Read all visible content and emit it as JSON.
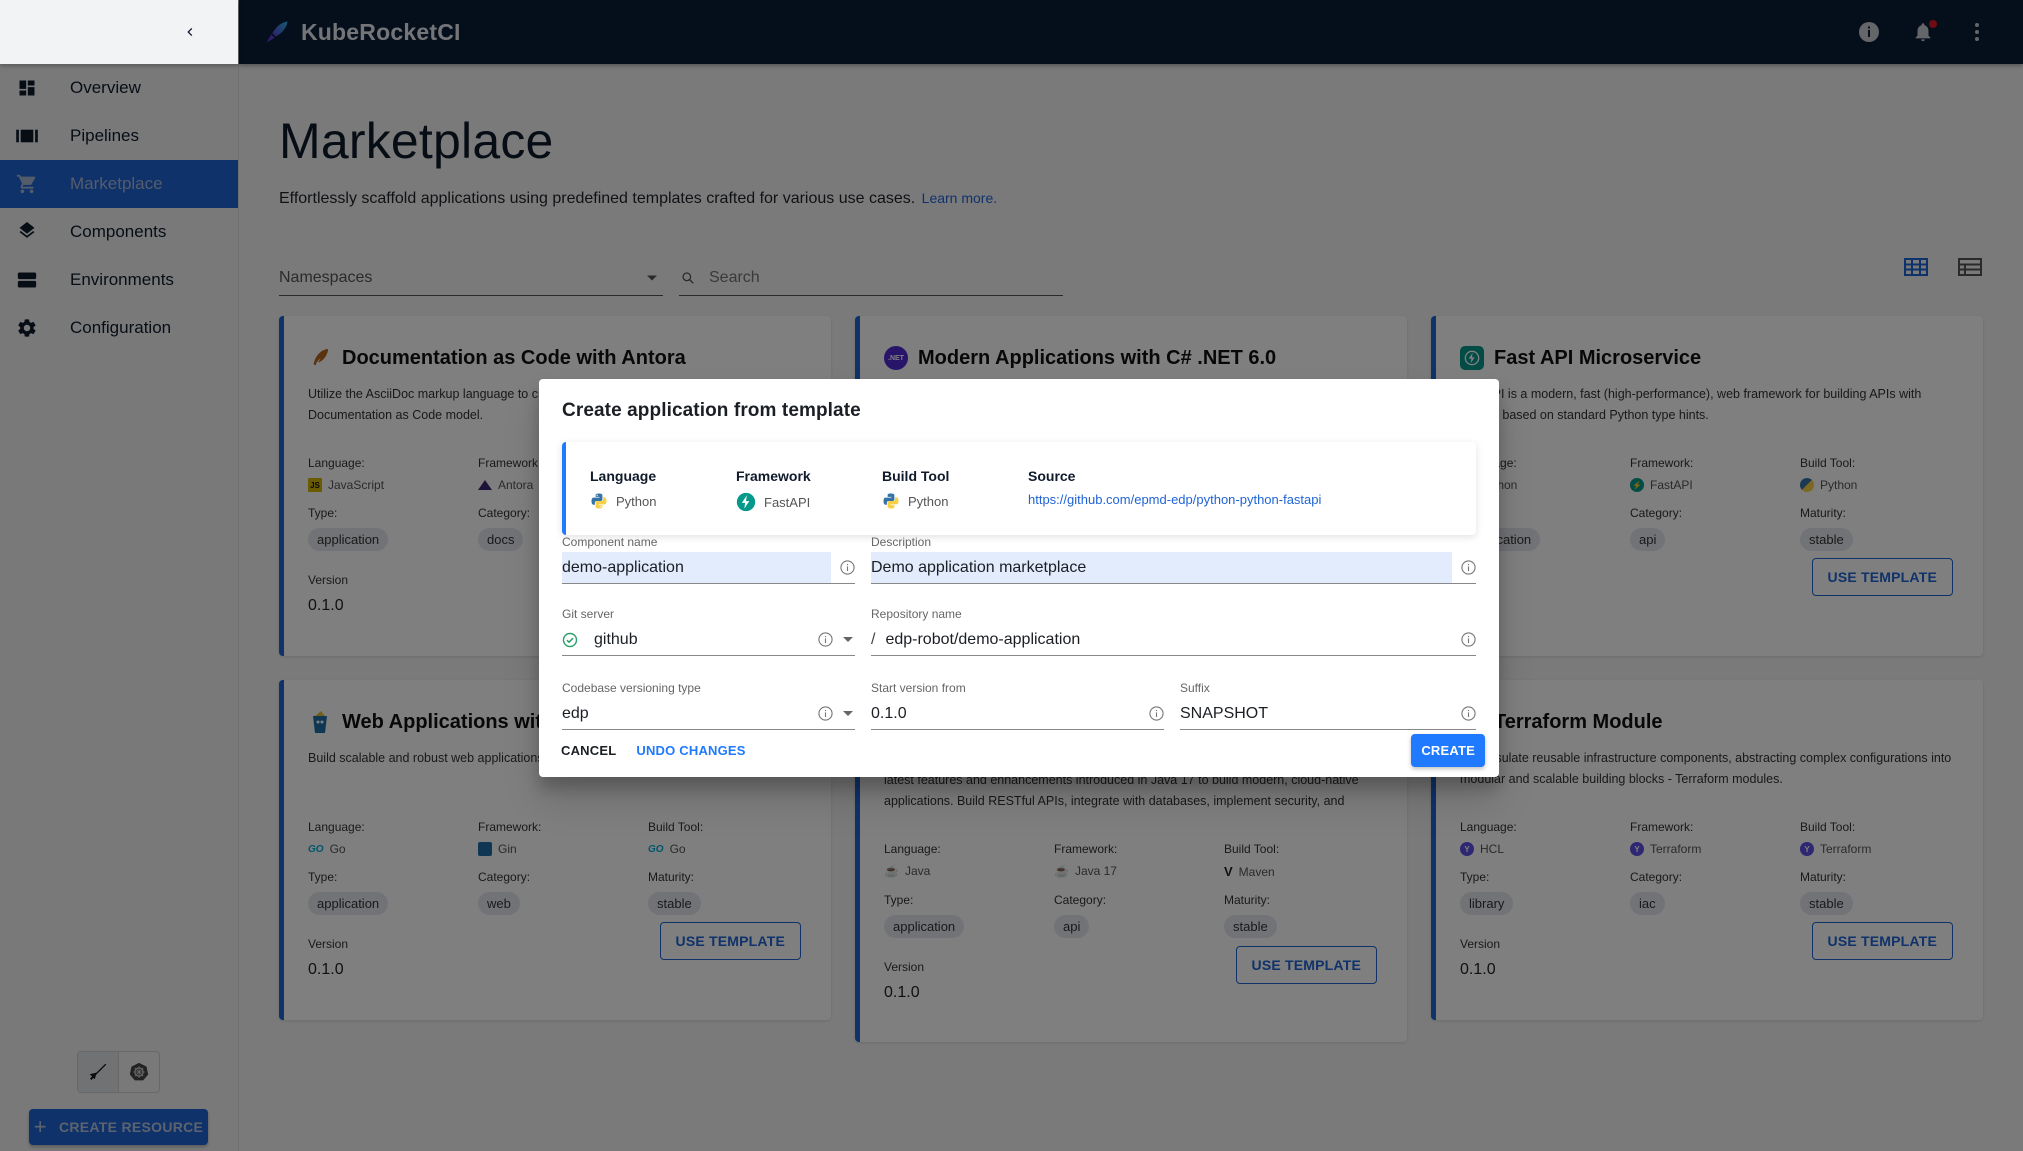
{
  "app": {
    "brand": "KubeRocketCI",
    "header_icons": [
      "info-icon",
      "notifications-icon",
      "more-vert-icon"
    ],
    "notification_badge": true
  },
  "sidebar": {
    "items": [
      {
        "label": "Overview",
        "icon": "dashboard-icon",
        "active": false
      },
      {
        "label": "Pipelines",
        "icon": "pipelines-icon",
        "active": false
      },
      {
        "label": "Marketplace",
        "icon": "cart-icon",
        "active": true
      },
      {
        "label": "Components",
        "icon": "layers-icon",
        "active": false
      },
      {
        "label": "Environments",
        "icon": "environments-icon",
        "active": false
      },
      {
        "label": "Configuration",
        "icon": "gear-icon",
        "active": false
      }
    ],
    "create_resource_label": "CREATE RESOURCE"
  },
  "page": {
    "title": "Marketplace",
    "subtitle": "Effortlessly scaffold applications using predefined templates crafted for various use cases.",
    "learn_more": "Learn more.",
    "namespaces_placeholder": "Namespaces",
    "search_placeholder": "Search"
  },
  "labels": {
    "language": "Language:",
    "framework": "Framework:",
    "build_tool": "Build Tool:",
    "type": "Type:",
    "category": "Category:",
    "maturity": "Maturity:",
    "version": "Version",
    "use_template": "USE TEMPLATE"
  },
  "cards": [
    {
      "title": "Documentation as Code with Antora",
      "description": "Utilize the AsciiDoc markup language to create documentation while adopting a Documentation as Code model.",
      "language": "JavaScript",
      "framework": "Antora",
      "build_tool": "",
      "type": "application",
      "category": "docs",
      "maturity": "",
      "version": "0.1.0"
    },
    {
      "title": "Modern Applications with C# .NET 6.0",
      "description": "",
      "language": "",
      "framework": "",
      "build_tool": "",
      "type": "",
      "category": "",
      "maturity": "",
      "version": ""
    },
    {
      "title": "Fast API Microservice",
      "description": "FastAPI is a modern, fast (high-performance), web framework for building APIs with Python based on standard Python type hints.",
      "language": "Python",
      "framework": "FastAPI",
      "build_tool": "Python",
      "type": "application",
      "category": "api",
      "maturity": "stable",
      "version": ""
    },
    {
      "title": "Web Applications with Gin",
      "description": "Build scalable and robust web applications using the Gin framework.",
      "language": "Go",
      "framework": "Gin",
      "build_tool": "Go",
      "type": "application",
      "category": "web",
      "maturity": "stable",
      "version": "0.1.0"
    },
    {
      "title": "",
      "description": "latest features and enhancements introduced in Java 17 to build modern, cloud-native applications. Build RESTful APIs, integrate with databases, implement security, and deploy...",
      "language": "Java",
      "framework": "Java 17",
      "build_tool": "Maven",
      "type": "application",
      "category": "api",
      "maturity": "stable",
      "version": "0.1.0"
    },
    {
      "title": "Terraform Module",
      "description": "Encapsulate reusable infrastructure components, abstracting complex configurations into modular and scalable building blocks - Terraform modules.",
      "language": "HCL",
      "framework": "Terraform",
      "build_tool": "Terraform",
      "type": "library",
      "category": "iac",
      "maturity": "stable",
      "version": "0.1.0"
    }
  ],
  "dialog": {
    "title": "Create application from template",
    "summary": {
      "language_label": "Language",
      "language": "Python",
      "framework_label": "Framework",
      "framework": "FastAPI",
      "build_tool_label": "Build Tool",
      "build_tool": "Python",
      "source_label": "Source",
      "source": "https://github.com/epmd-edp/python-python-fastapi"
    },
    "fields": {
      "component_name": {
        "label": "Component name",
        "value": "demo-application"
      },
      "description": {
        "label": "Description",
        "value": "Demo application marketplace"
      },
      "git_server": {
        "label": "Git server",
        "value": "github"
      },
      "repository_name": {
        "label": "Repository name",
        "prefix": "/",
        "value": "edp-robot/demo-application"
      },
      "versioning_type": {
        "label": "Codebase versioning type",
        "value": "edp"
      },
      "start_version": {
        "label": "Start version from",
        "value": "0.1.0"
      },
      "suffix": {
        "label": "Suffix",
        "value": "SNAPSHOT"
      }
    },
    "cancel_label": "CANCEL",
    "undo_label": "UNDO CHANGES",
    "create_label": "CREATE"
  },
  "colors": {
    "primary": "#1f64d6",
    "header_bg": "#0b1d36",
    "dialog_accent": "#1f7aff",
    "success": "#2e9e6b"
  }
}
